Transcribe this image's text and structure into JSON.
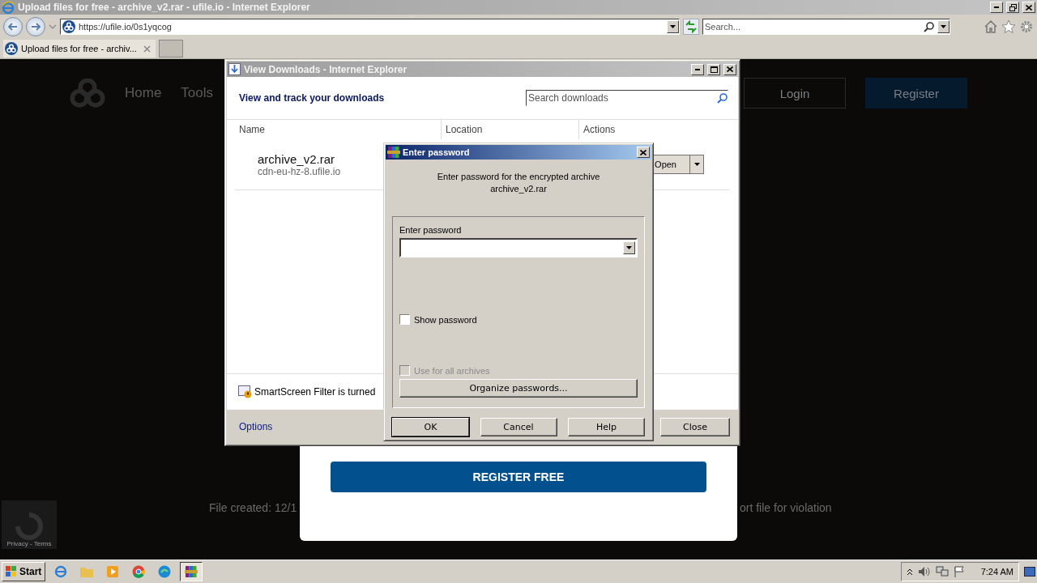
{
  "browser": {
    "title": "Upload files for free - archive_v2.rar - ufile.io - Internet Explorer",
    "address": "https://ufile.io/0s1yqcog",
    "search_placeholder": "Search...",
    "tabs": [
      {
        "label": "Upload files for free - archiv...",
        "selected": true
      }
    ]
  },
  "page": {
    "nav": [
      "Home",
      "Tools"
    ],
    "login": "Login",
    "register": "Register",
    "footer_left": "File created: 12/1",
    "footer_right": "ort file for violation",
    "recaptcha": "Privacy - Terms",
    "modal_button": "REGISTER FREE"
  },
  "downloads": {
    "title": "View Downloads - Internet Explorer",
    "heading": "View and track your downloads",
    "search_placeholder": "Search downloads",
    "columns": [
      "Name",
      "Location",
      "Actions"
    ],
    "items": [
      {
        "name": "archive_v2.rar",
        "source": "cdn-eu-hz-8.ufile.io",
        "action": "Open"
      }
    ],
    "smartscreen": "SmartScreen Filter is turned",
    "options": "Options",
    "close": "Close"
  },
  "password_dialog": {
    "title": "Enter password",
    "message_lines": [
      "Enter password for the encrypted archive",
      "archive_v2.rar"
    ],
    "field_label": "Enter password",
    "checkboxes": [
      {
        "label": "Show password",
        "checked": false,
        "disabled": false
      },
      {
        "label": "Use for all archives",
        "checked": false,
        "disabled": true
      }
    ],
    "organize": "Organize passwords...",
    "buttons": [
      {
        "label": "OK",
        "default": true
      },
      {
        "label": "Cancel",
        "default": false
      },
      {
        "label": "Help",
        "default": false
      }
    ]
  },
  "taskbar": {
    "start": "Start",
    "time": "7:24 AM"
  }
}
